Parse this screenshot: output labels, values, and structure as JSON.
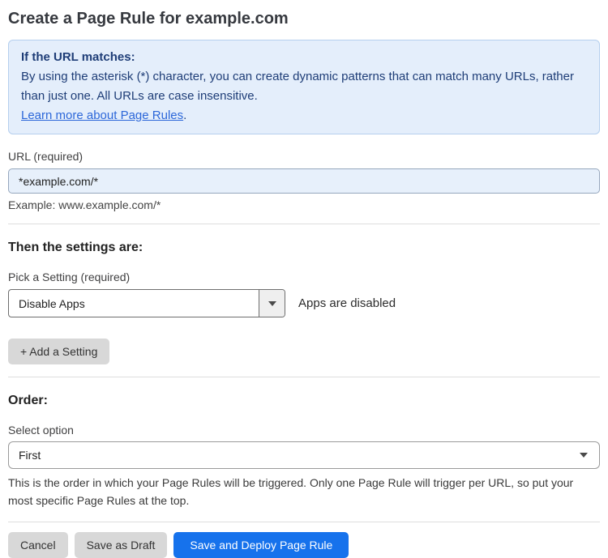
{
  "page_title": "Create a Page Rule for example.com",
  "info_box": {
    "heading": "If the URL matches:",
    "body": "By using the asterisk (*) character, you can create dynamic patterns that can match many URLs, rather than just one. All URLs are case insensitive.",
    "link_text": "Learn more about Page Rules",
    "link_suffix": "."
  },
  "url_field": {
    "label": "URL (required)",
    "value": "*example.com/*",
    "helper": "Example: www.example.com/*"
  },
  "settings_section": {
    "heading": "Then the settings are:",
    "setting_label": "Pick a Setting (required)",
    "setting_value": "Disable Apps",
    "setting_status": "Apps are disabled",
    "add_setting_label": "+ Add a Setting"
  },
  "order_section": {
    "heading": "Order:",
    "select_label": "Select option",
    "select_value": "First",
    "helper": "This is the order in which your Page Rules will be triggered. Only one Page Rule will trigger per URL, so put your most specific Page Rules at the top."
  },
  "footer": {
    "cancel_label": "Cancel",
    "save_draft_label": "Save as Draft",
    "save_deploy_label": "Save and Deploy Page Rule"
  },
  "colors": {
    "accent_blue": "#1672ec",
    "info_bg": "#e4eefb",
    "info_border": "#b5cfee",
    "info_text": "#1e3d77",
    "link_blue": "#2c67d9",
    "input_bg": "#e7f0fb"
  }
}
